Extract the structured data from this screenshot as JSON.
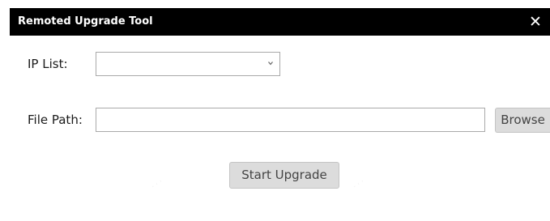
{
  "window": {
    "title": "Remoted Upgrade Tool",
    "close_symbol": "✕"
  },
  "form": {
    "ip_list": {
      "label": "IP List:",
      "selected_value": "",
      "arrow_icon": "chevron-down-icon"
    },
    "file_path": {
      "label": "File Path:",
      "value": "",
      "placeholder": ""
    }
  },
  "buttons": {
    "browse_label": "Browse",
    "start_label": "Start Upgrade"
  },
  "colors": {
    "titlebar_bg": "#000000",
    "titlebar_text": "#ffffff",
    "button_bg": "#dcdcdc",
    "input_border": "#a9a9a9"
  }
}
